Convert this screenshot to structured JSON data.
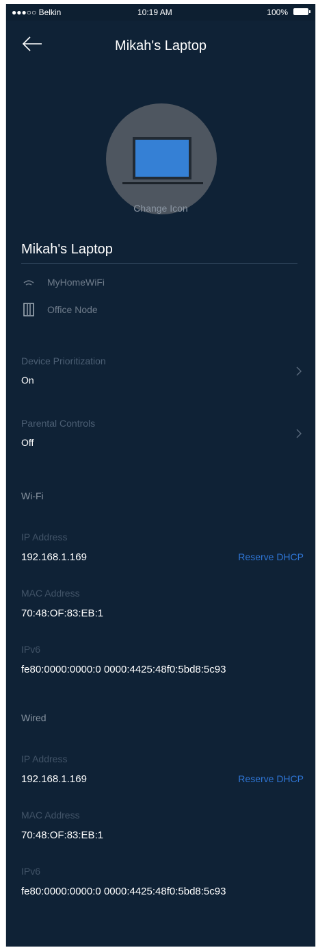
{
  "status_bar": {
    "carrier": "●●●○○ Belkin",
    "time": "10:19 AM",
    "battery": "100%"
  },
  "nav": {
    "title": "Mikah's Laptop",
    "back_icon": "back-arrow-icon"
  },
  "device": {
    "icon": "laptop-icon",
    "change_icon_label": "Change Icon",
    "name": "Mikah's Laptop",
    "network": "MyHomeWiFi",
    "node": "Office Node"
  },
  "settings": [
    {
      "label": "Device Prioritization",
      "value": "On"
    },
    {
      "label": "Parental Controls",
      "value": "Off"
    }
  ],
  "wifi": {
    "title": "Wi-Fi",
    "ip_label": "IP Address",
    "ip": "192.168.1.169",
    "reserve": "Reserve DHCP",
    "mac_label": "MAC Address",
    "mac": "70:48:OF:83:EB:1",
    "ipv6_label": "IPv6",
    "ipv6": "fe80:0000:0000:0 0000:4425:48f0:5bd8:5c93"
  },
  "wired": {
    "title": "Wired",
    "ip_label": "IP Address",
    "ip": "192.168.1.169",
    "reserve": "Reserve DHCP",
    "mac_label": "MAC Address",
    "mac": "70:48:OF:83:EB:1",
    "ipv6_label": "IPv6",
    "ipv6": "fe80:0000:0000:0 0000:4425:48f0:5bd8:5c93"
  },
  "colors": {
    "background": "#0f2236",
    "accent": "#2f76d6",
    "muted_text": "#4c5f74"
  }
}
